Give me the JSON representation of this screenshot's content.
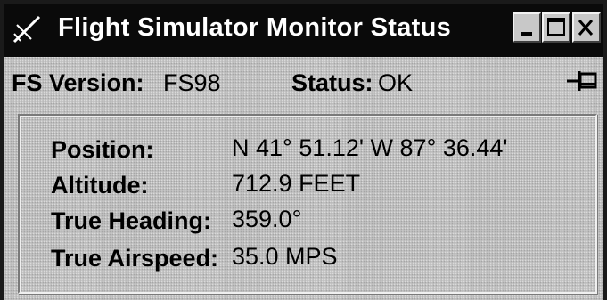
{
  "window": {
    "title": "Flight Simulator Monitor Status",
    "icon": "airplane-icon",
    "controls": [
      "minimize-icon",
      "maximize-icon",
      "close-icon"
    ]
  },
  "header": {
    "fs_version_label": "FS Version:",
    "fs_version_value": "FS98",
    "status_label": "Status:",
    "status_value": "OK",
    "pin_icon": "pin-icon"
  },
  "details": {
    "position_label": "Position:",
    "position_value": "N 41° 51.12'  W 87° 36.44'",
    "altitude_label": "Altitude:",
    "altitude_value": "712.9 FEET",
    "heading_label": "True Heading:",
    "heading_value": "359.0°",
    "airspeed_label": "True Airspeed:",
    "airspeed_value": "35.0 MPS"
  },
  "colors": {
    "titlebar": "#0a0a0a",
    "title_text": "#ffffff",
    "window_face": "#c0c0c0"
  }
}
